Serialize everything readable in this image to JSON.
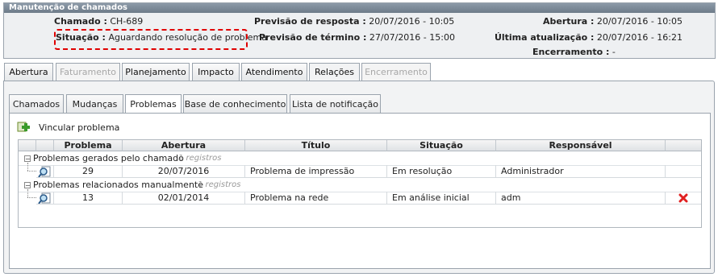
{
  "panel": {
    "title": "Manutenção de chamados",
    "chamado_label": "Chamado :",
    "chamado_value": "CH-689",
    "situacao_label": "Situação :",
    "situacao_value": "Aguardando resolução de problema",
    "prev_resposta_label": "Previsão de resposta :",
    "prev_resposta_value": "20/07/2016 - 10:05",
    "prev_termino_label": "Previsão de término :",
    "prev_termino_value": "27/07/2016 - 15:00",
    "abertura_label": "Abertura :",
    "abertura_value": "20/07/2016 - 10:05",
    "ultima_label": "Última atualização :",
    "ultima_value": "20/07/2016 - 16:21",
    "encerramento_label": "Encerramento :",
    "encerramento_value": "-",
    "highlight_color": "#e00000"
  },
  "main_tabs": [
    {
      "label": "Abertura",
      "state": "normal"
    },
    {
      "label": "Faturamento",
      "state": "disabled"
    },
    {
      "label": "Planejamento",
      "state": "normal"
    },
    {
      "label": "Impacto",
      "state": "normal"
    },
    {
      "label": "Atendimento",
      "state": "normal"
    },
    {
      "label": "Relações",
      "state": "active"
    },
    {
      "label": "Encerramento",
      "state": "disabled"
    }
  ],
  "sub_tabs": [
    {
      "label": "Chamados",
      "state": "normal"
    },
    {
      "label": "Mudanças",
      "state": "normal"
    },
    {
      "label": "Problemas",
      "state": "active"
    },
    {
      "label": "Base de conhecimento",
      "state": "normal"
    },
    {
      "label": "Lista de notificação",
      "state": "normal"
    }
  ],
  "toolbar": {
    "link_label": "Vincular problema",
    "link_icon": "add-link-icon"
  },
  "grid": {
    "columns": [
      "Problema",
      "Abertura",
      "Título",
      "Situação",
      "Responsável"
    ],
    "groups": [
      {
        "label": "Problemas gerados pelo chamado",
        "count": "1 registros",
        "rows": [
          {
            "problema": "29",
            "abertura": "20/07/2016",
            "titulo": "Problema de impressão",
            "situacao": "Em resolução",
            "responsavel": "Administrador",
            "deletable": false
          }
        ]
      },
      {
        "label": "Problemas relacionados manualmente",
        "count": "1 registros",
        "rows": [
          {
            "problema": "13",
            "abertura": "02/01/2014",
            "titulo": "Problema na rede",
            "situacao": "Em análise inicial",
            "responsavel": "adm",
            "deletable": true
          }
        ]
      }
    ]
  }
}
